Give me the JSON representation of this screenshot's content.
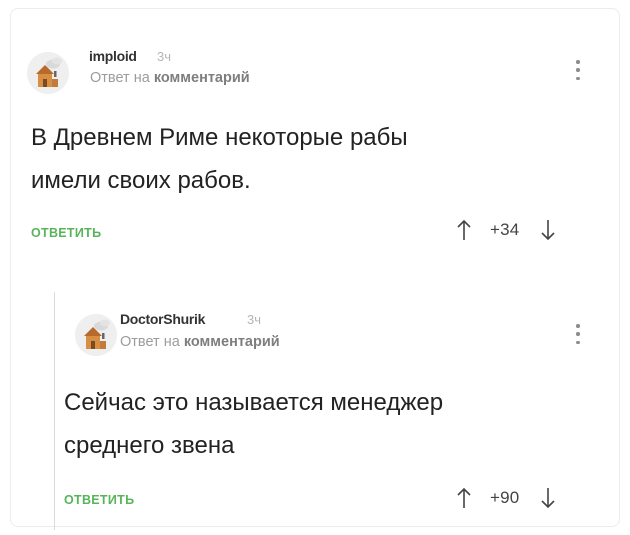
{
  "comment1": {
    "author": "imploid",
    "time": "3ч",
    "reply_prefix": "Ответ на",
    "reply_target": "комментарий",
    "body_lines": [
      "В Древнем Риме некоторые рабы",
      "имели своих рабов."
    ],
    "reply_label": "ОТВЕТИТЬ",
    "score": "+34"
  },
  "comment2": {
    "author": "DoctorShurik",
    "time": "3ч",
    "reply_prefix": "Ответ на",
    "reply_target": "комментарий",
    "body_lines": [
      "Сейчас это называется менеджер",
      "среднего звена"
    ],
    "reply_label": "ОТВЕТИТЬ",
    "score": "+90"
  },
  "colors": {
    "accent_green": "#58b45a",
    "muted_gray": "#9c9c9c",
    "text": "#222222"
  }
}
